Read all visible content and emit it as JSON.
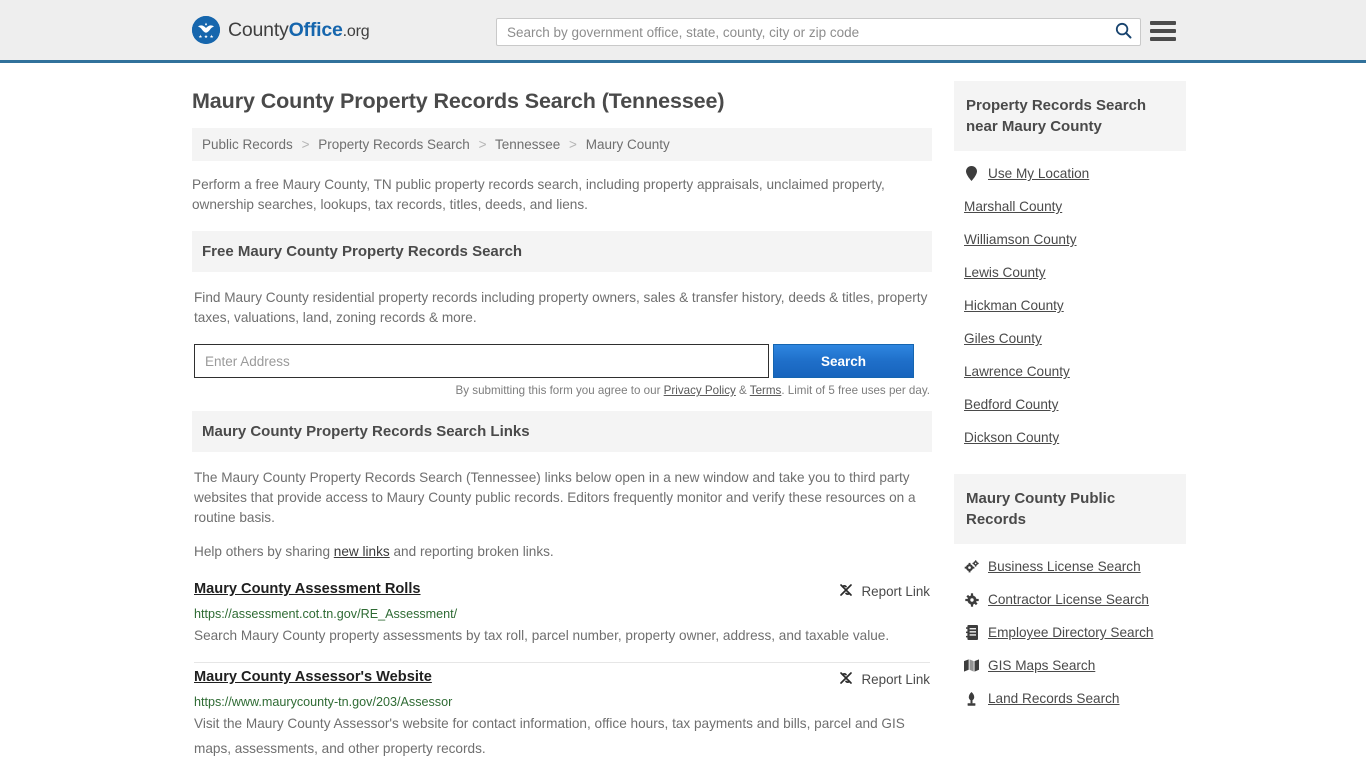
{
  "header": {
    "logo": {
      "part1": "County",
      "part2": "Office",
      "part3": ".org",
      "icon": "eagle-seal-logo"
    },
    "search": {
      "placeholder": "Search by government office, state, county, city or zip code",
      "value": "",
      "icon": "search-icon"
    },
    "menu_icon": "hamburger-menu-icon"
  },
  "main": {
    "title": "Maury County Property Records Search (Tennessee)",
    "breadcrumb": [
      "Public Records",
      "Property Records Search",
      "Tennessee",
      "Maury County"
    ],
    "breadcrumb_separator": ">",
    "intro": "Perform a free Maury County, TN public property records search, including property appraisals, unclaimed property, ownership searches, lookups, tax records, titles, deeds, and liens.",
    "free_search": {
      "heading": "Free Maury County Property Records Search",
      "description": "Find Maury County residential property records including property owners, sales & transfer history, deeds & titles, property taxes, valuations, land, zoning records & more.",
      "address_placeholder": "Enter Address",
      "address_value": "",
      "search_button": "Search",
      "legal_prefix": "By submitting this form you agree to our ",
      "legal_privacy": "Privacy Policy",
      "legal_amp": " & ",
      "legal_terms": "Terms",
      "legal_suffix": ". Limit of 5 free uses per day."
    },
    "links_section": {
      "heading": "Maury County Property Records Search Links",
      "paragraph": "The Maury County Property Records Search (Tennessee) links below open in a new window and take you to third party websites that provide access to Maury County public records. Editors frequently monitor and verify these resources on a routine basis.",
      "help_prefix": "Help others by sharing ",
      "help_link": "new links",
      "help_suffix": " and reporting broken links.",
      "report_label": "Report Link",
      "report_icon": "broken-link-icon",
      "results": [
        {
          "title": "Maury County Assessment Rolls",
          "url": "https://assessment.cot.tn.gov/RE_Assessment/",
          "description": "Search Maury County property assessments by tax roll, parcel number, property owner, address, and taxable value."
        },
        {
          "title": "Maury County Assessor's Website",
          "url": "https://www.maurycounty-tn.gov/203/Assessor",
          "description": "Visit the Maury County Assessor's website for contact information, office hours, tax payments and bills, parcel and GIS maps, assessments, and other property records."
        }
      ]
    }
  },
  "sidebar": {
    "nearby": {
      "heading": "Property Records Search near Maury County",
      "items": [
        {
          "label": "Use My Location",
          "icon": "map-marker-icon"
        },
        {
          "label": "Marshall County",
          "icon": ""
        },
        {
          "label": "Williamson County",
          "icon": ""
        },
        {
          "label": "Lewis County",
          "icon": ""
        },
        {
          "label": "Hickman County",
          "icon": ""
        },
        {
          "label": "Giles County",
          "icon": ""
        },
        {
          "label": "Lawrence County",
          "icon": ""
        },
        {
          "label": "Bedford County",
          "icon": ""
        },
        {
          "label": "Dickson County",
          "icon": ""
        }
      ]
    },
    "public_records": {
      "heading": "Maury County Public Records",
      "items": [
        {
          "label": "Business License Search",
          "icon": "cogs-icon"
        },
        {
          "label": "Contractor License Search",
          "icon": "cog-icon"
        },
        {
          "label": "Employee Directory Search",
          "icon": "address-book-icon"
        },
        {
          "label": "GIS Maps Search",
          "icon": "map-icon"
        },
        {
          "label": "Land Records Search",
          "icon": "monument-icon"
        }
      ]
    }
  },
  "colors": {
    "brand_blue": "#1666ad",
    "header_rule": "#31719b",
    "header_bg": "#eeeeee",
    "panel_bg": "#f4f4f4",
    "url_green": "#2f6b34",
    "button_blue": "#1f6fc9"
  }
}
